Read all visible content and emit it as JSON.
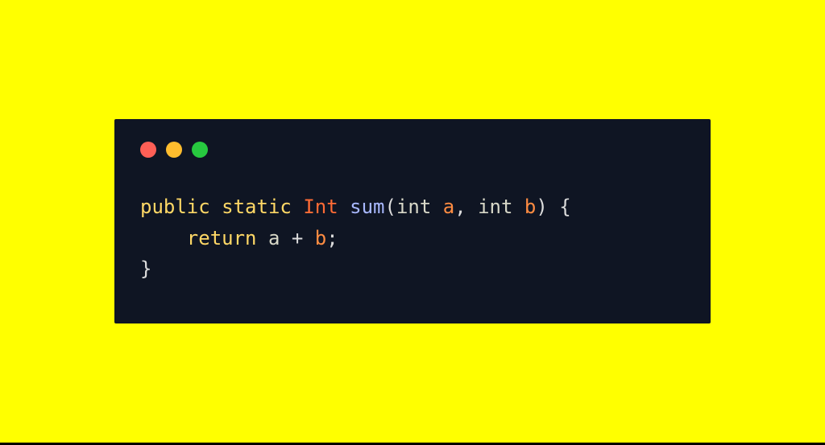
{
  "traffic_lights": {
    "colors": {
      "red": "#ff5f56",
      "yellow": "#ffbd2e",
      "green": "#27c93f"
    }
  },
  "code": {
    "line1": {
      "kw_public": "public",
      "kw_static": "static",
      "type": "Int",
      "fn_name": "sum",
      "paren_open": "(",
      "p1_type": "int",
      "p1_name": "a",
      "comma": ",",
      "p2_type": "int",
      "p2_name": "b",
      "paren_close": ")",
      "brace_open": "{"
    },
    "line2": {
      "indent": "    ",
      "kw_return": "return",
      "var_a": "a",
      "op_plus": "+",
      "var_b": "b",
      "semicolon": ";"
    },
    "line3": {
      "brace_close": "}"
    }
  }
}
